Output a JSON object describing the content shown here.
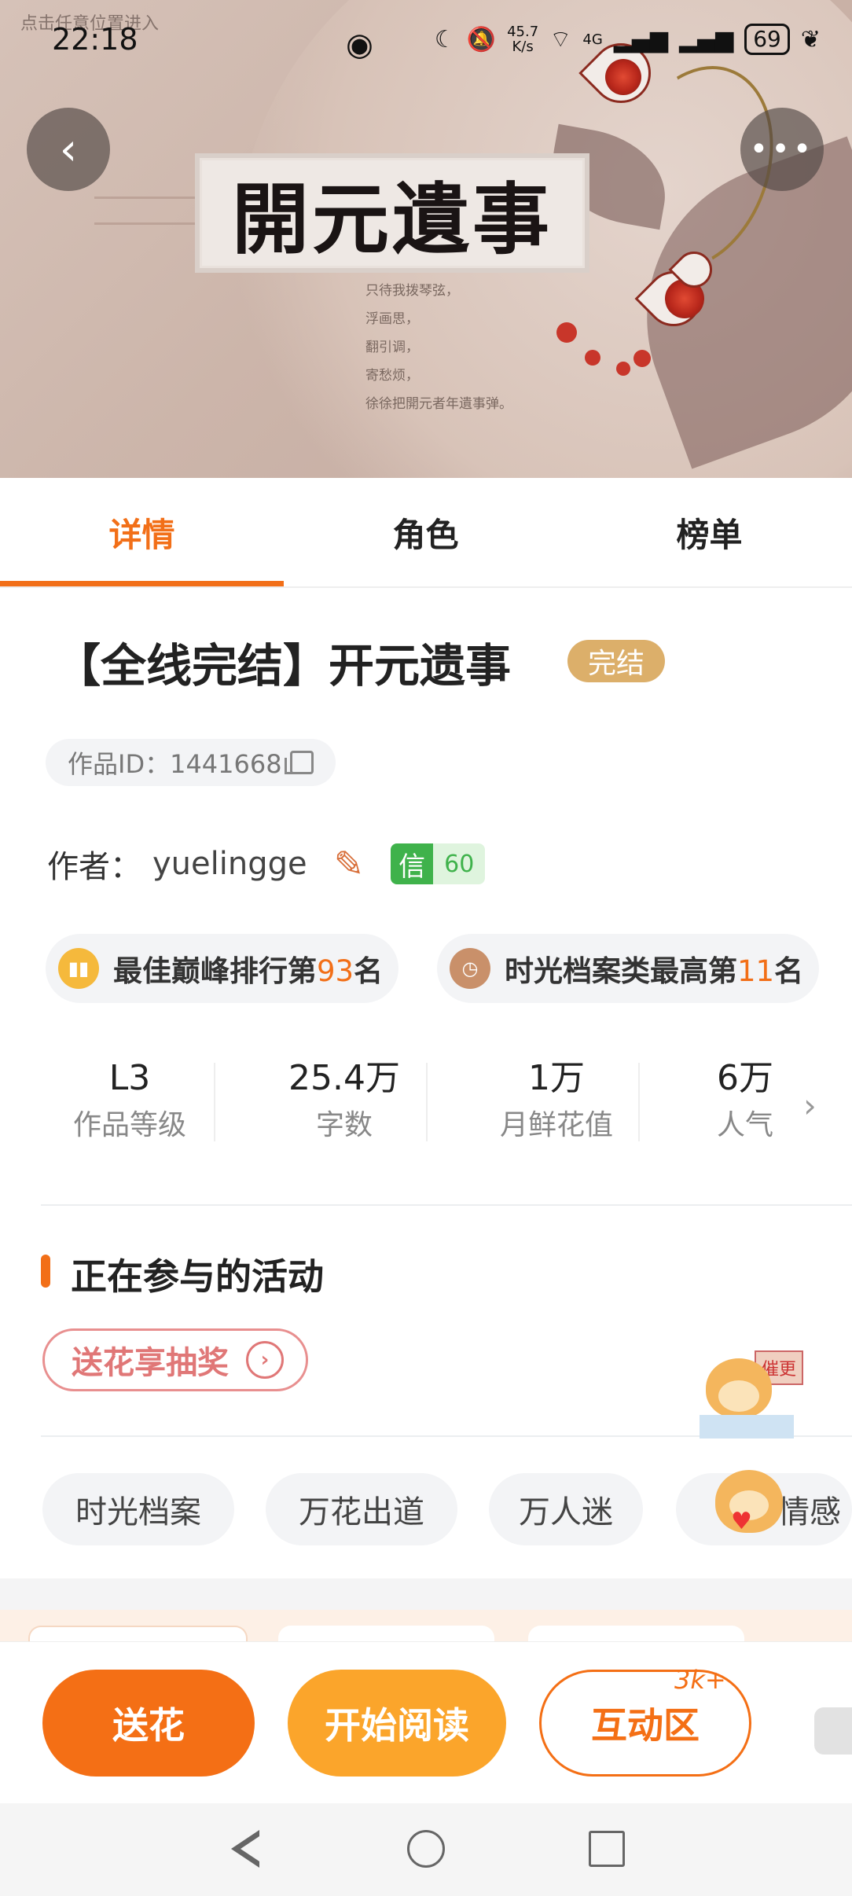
{
  "status_bar": {
    "time": "22:18",
    "network_speed": "45.7",
    "network_unit": "K/s",
    "network_type": "4G",
    "battery": "69"
  },
  "banner": {
    "watermark": "点击任意位置进入",
    "calligraphy_title": "開元遺事",
    "poem": "只待我拨琴弦，\n浮画思，\n翻引调，\n寄愁烦，\n徐徐把開元者年遺事弹。"
  },
  "tabs": [
    {
      "label": "详情"
    },
    {
      "label": "角色"
    },
    {
      "label": "榜单"
    }
  ],
  "book": {
    "title": "【全线完结】开元遗事",
    "status_badge": "完结",
    "work_id": "作品ID：1441668",
    "author_label": "作者：",
    "author_name": "yuelingge",
    "credit_key": "信",
    "credit_value": "60"
  },
  "ranks": [
    {
      "prefix": "最佳巅峰排行第",
      "num": "93",
      "suffix": "名"
    },
    {
      "prefix": "时光档案类最高第",
      "num": "11",
      "suffix": "名"
    }
  ],
  "stats": [
    {
      "value": "L3",
      "label": "作品等级"
    },
    {
      "value": "25.4万",
      "label": "字数"
    },
    {
      "value": "1万",
      "label": "月鲜花值"
    },
    {
      "value": "6万",
      "label": "人气"
    }
  ],
  "activity": {
    "section_title": "正在参与的活动",
    "lottery_label": "送花享抽奖"
  },
  "tags": [
    "时光档案",
    "万花出道",
    "万人迷",
    "情感"
  ],
  "mascot": {
    "sign_text": "催更"
  },
  "bottom_bar": {
    "flower_label": "送花",
    "read_label": "开始阅读",
    "interact_label": "互动区",
    "interact_count": "3k+"
  },
  "colors": {
    "accent": "#f26f18",
    "read_button": "#fba52b",
    "complete_badge": "#dcaf6a"
  }
}
